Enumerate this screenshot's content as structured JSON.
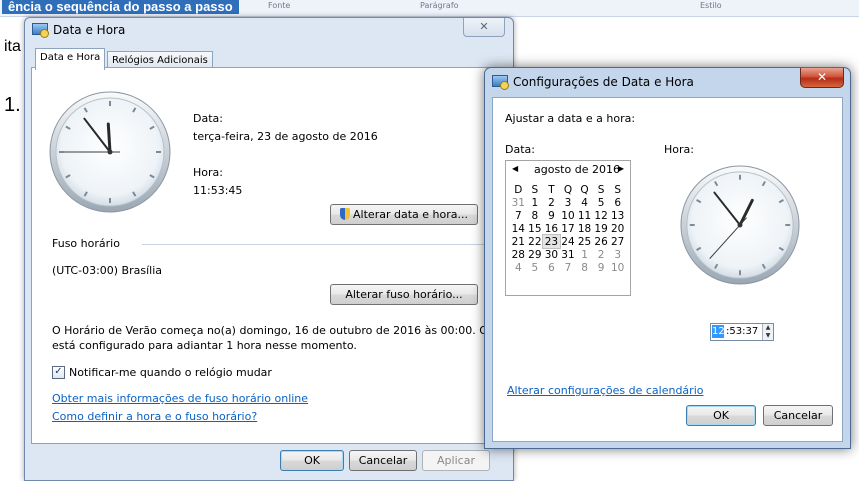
{
  "background": {
    "heading": "ência o sequência do passo a passo",
    "ribbon_items": [
      "Fonte",
      "Parágrafo",
      "Estilo"
    ],
    "text_ita": "ita",
    "text_list_number": "1."
  },
  "main_dialog": {
    "title": "Data e Hora",
    "close_label": "✕",
    "tabs": [
      "Data e Hora",
      "Relógios Adicionais"
    ],
    "date_label": "Data:",
    "date_value": "terça-feira, 23 de agosto de 2016",
    "time_label": "Hora:",
    "time_value": "11:53:45",
    "change_datetime_button": "Alterar data e hora...",
    "timezone_section": "Fuso horário",
    "timezone_value": "(UTC-03:00) Brasília",
    "change_timezone_button": "Alterar fuso horário...",
    "dst_message_line1": "O Horário de Verão começa no(a) domingo, 16 de outubro de 2016 às 00:00. O relógio",
    "dst_message_line2": "está configurado para adiantar 1 hora nesse momento.",
    "notify_checkbox_label": "Notificar-me quando o relógio mudar",
    "notify_checked": true,
    "link_more_info": "Obter mais informações de fuso horário online",
    "link_how_to": "Como definir a hora e o fuso horário?",
    "ok_button": "OK",
    "cancel_button": "Cancelar",
    "apply_button": "Aplicar",
    "clock_time": {
      "hour": 11,
      "minute": 53,
      "second": 45
    }
  },
  "settings_dialog": {
    "title": "Configurações de Data e Hora",
    "close_label": "✕",
    "instruction": "Ajustar a data e a hora:",
    "date_label": "Data:",
    "time_label": "Hora:",
    "calendar": {
      "month_title": "agosto de 2016",
      "prev_arrow": "◀",
      "next_arrow": "▶",
      "weekdays": [
        "D",
        "S",
        "T",
        "Q",
        "Q",
        "S",
        "S"
      ],
      "weeks": [
        [
          "31",
          "1",
          "2",
          "3",
          "4",
          "5",
          "6"
        ],
        [
          "7",
          "8",
          "9",
          "10",
          "11",
          "12",
          "13"
        ],
        [
          "14",
          "15",
          "16",
          "17",
          "18",
          "19",
          "20"
        ],
        [
          "21",
          "22",
          "23",
          "24",
          "25",
          "26",
          "27"
        ],
        [
          "28",
          "29",
          "30",
          "31",
          "1",
          "2",
          "3"
        ],
        [
          "4",
          "5",
          "6",
          "7",
          "8",
          "9",
          "10"
        ]
      ],
      "selected_day": "23"
    },
    "time_hour": "12",
    "time_rest": ":53:37",
    "link_calendar_settings": "Alterar configurações de calendário",
    "ok_button": "OK",
    "cancel_button": "Cancelar",
    "clock_time": {
      "hour": 12,
      "minute": 53,
      "second": 37
    }
  }
}
